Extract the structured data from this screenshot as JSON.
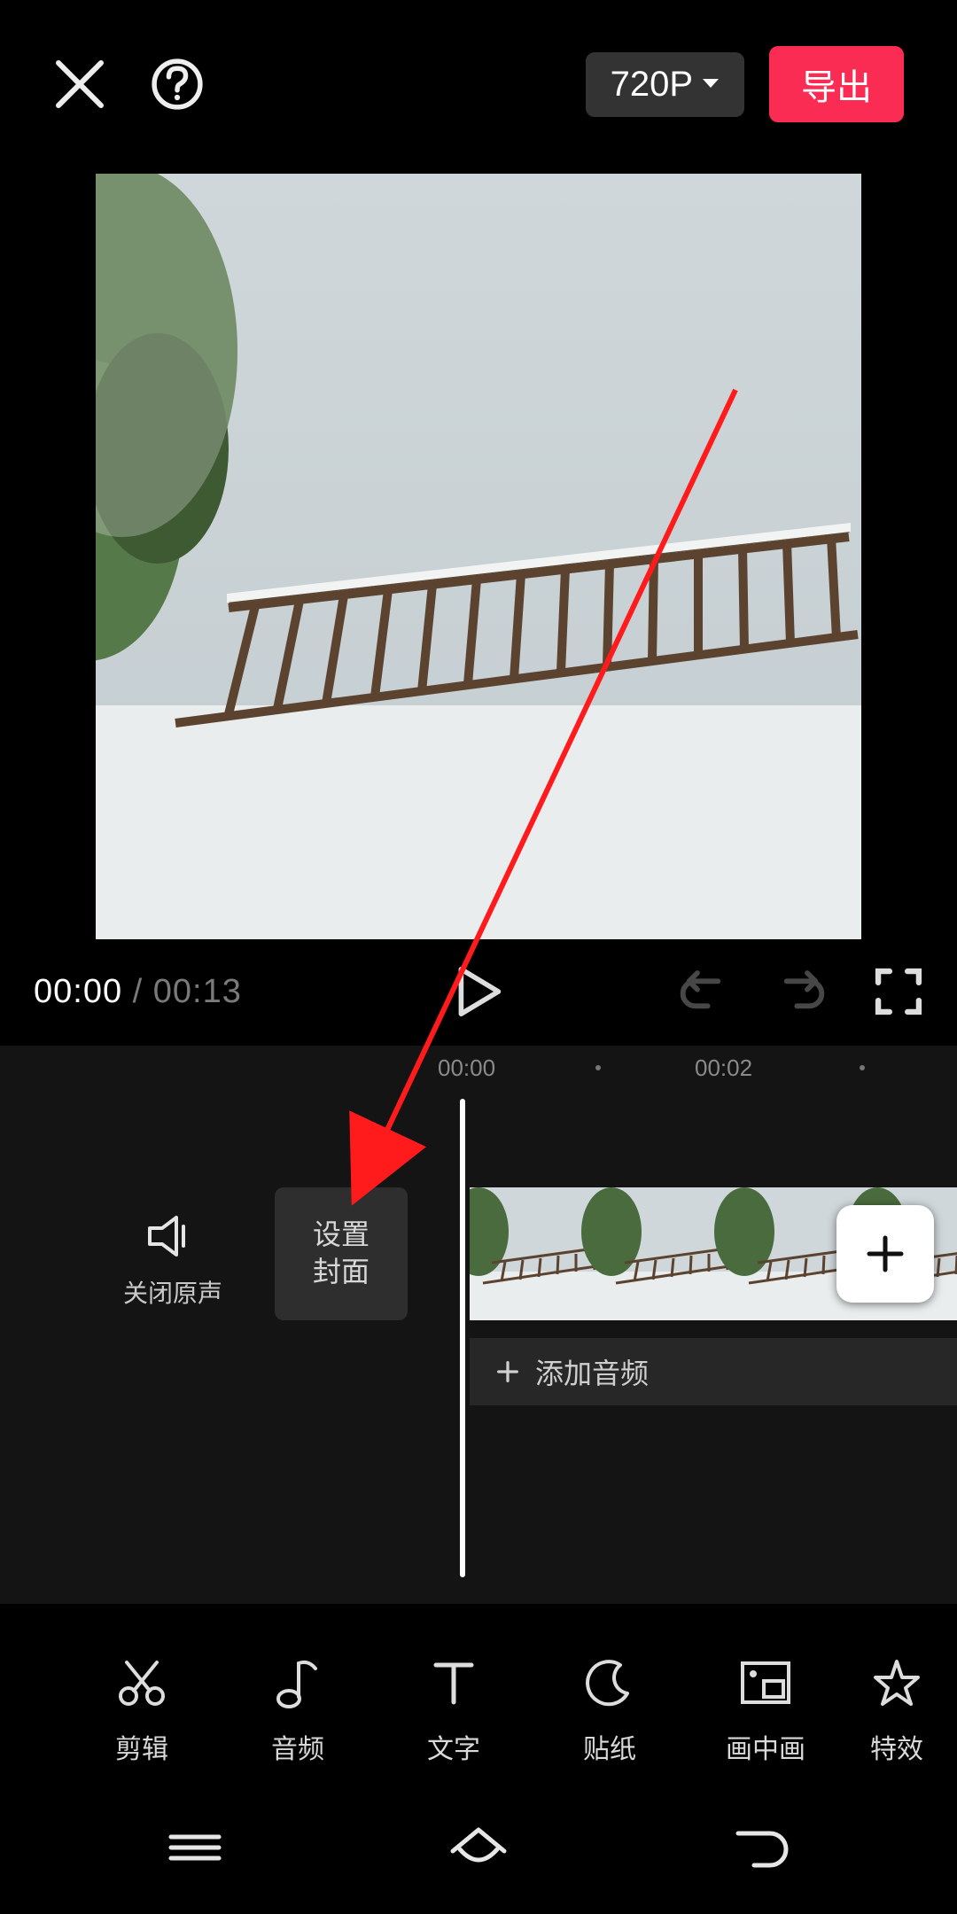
{
  "header": {
    "resolution_label": "720P",
    "export_label": "导出"
  },
  "transport": {
    "current_time": "00:00",
    "separator": " / ",
    "total_time": "00:13"
  },
  "timeline": {
    "tick_labels": [
      "00:00",
      "00:02"
    ],
    "mute_label": "关闭原声",
    "cover_label": "设置\n封面",
    "add_audio_label": "添加音频"
  },
  "tools": [
    {
      "id": "edit",
      "label": "剪辑",
      "icon": "scissors-icon"
    },
    {
      "id": "audio",
      "label": "音频",
      "icon": "music-note-icon"
    },
    {
      "id": "text",
      "label": "文字",
      "icon": "text-icon"
    },
    {
      "id": "sticker",
      "label": "贴纸",
      "icon": "moon-icon"
    },
    {
      "id": "pip",
      "label": "画中画",
      "icon": "picture-in-picture-icon"
    },
    {
      "id": "effect",
      "label": "特效",
      "icon": "star-icon"
    }
  ],
  "colors": {
    "accent": "#fb2c53",
    "panel": "#141414"
  }
}
